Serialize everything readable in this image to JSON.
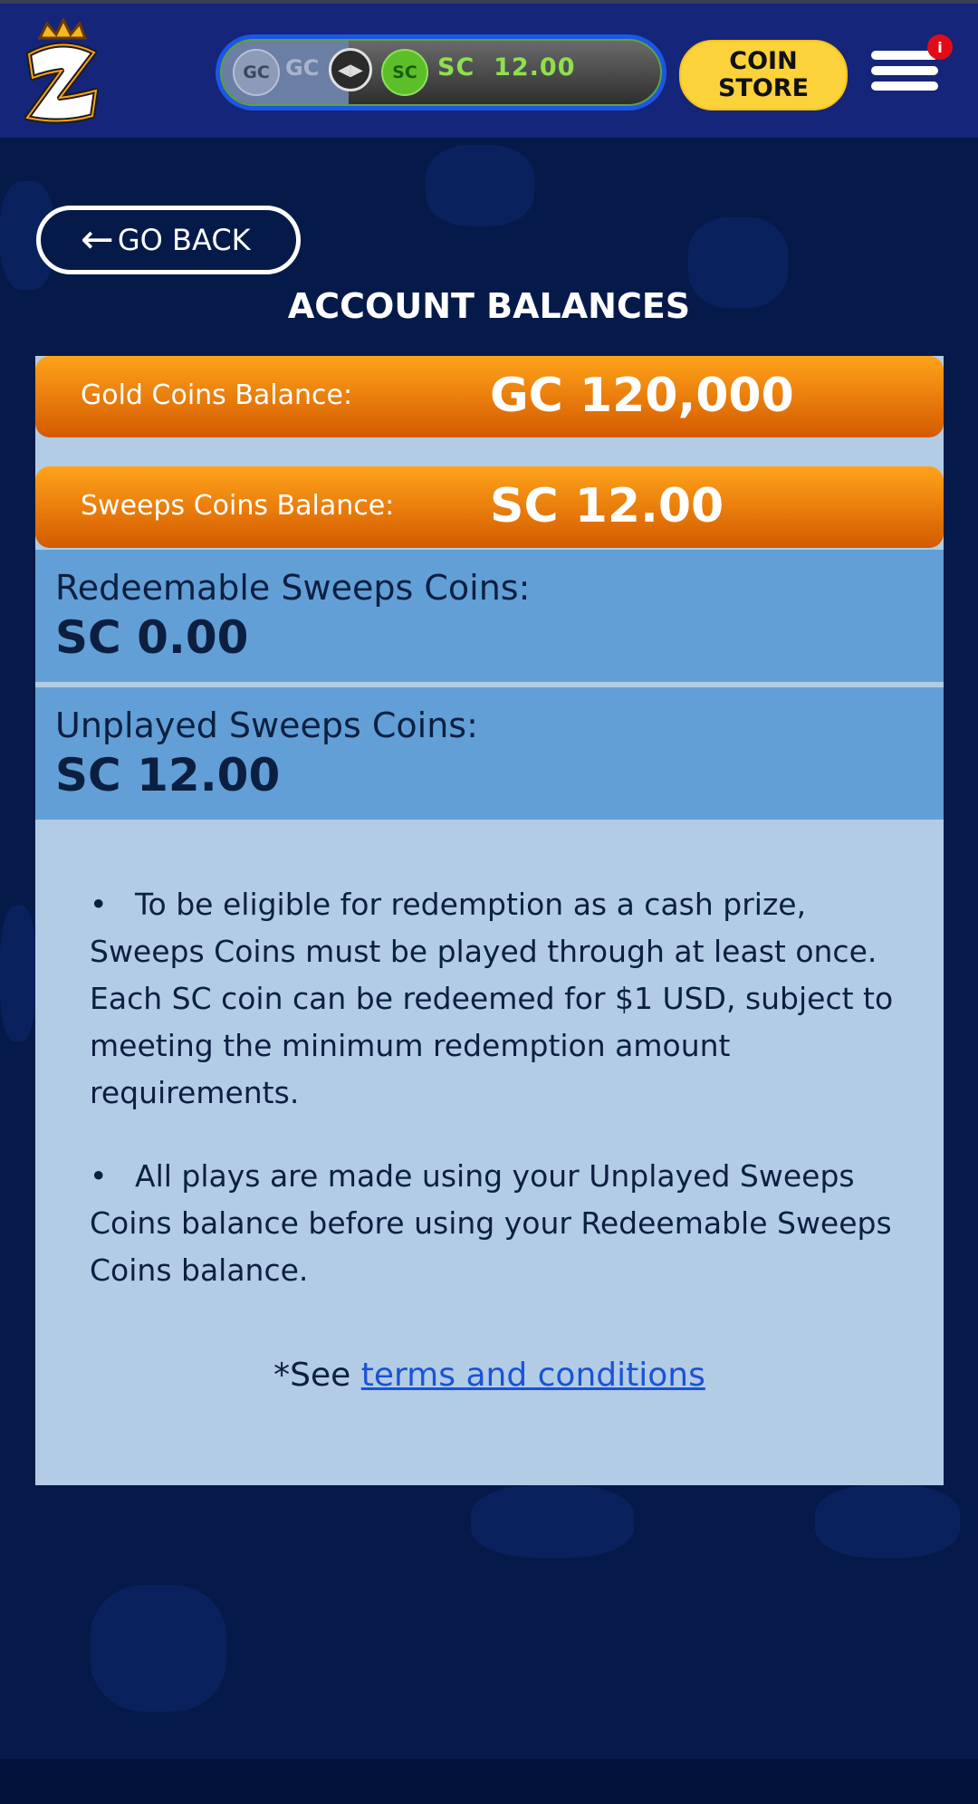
{
  "header": {
    "logo_letter": "Z",
    "toggle": {
      "gc_coin": "GC",
      "gc_label": "GC",
      "sc_coin": "SC",
      "sc_label": "SC",
      "sc_amount": "12.00"
    },
    "coin_store": {
      "line1": "COIN",
      "line2": "STORE"
    },
    "menu_badge": "i"
  },
  "go_back_label": "GO BACK",
  "page_title": "ACCOUNT BALANCES",
  "balances": {
    "gold": {
      "label": "Gold Coins Balance:",
      "value": "GC 120,000"
    },
    "sweeps": {
      "label": "Sweeps Coins Balance:",
      "value": "SC 12.00"
    },
    "redeemable": {
      "label": "Redeemable Sweeps Coins:",
      "value": "SC 0.00"
    },
    "unplayed": {
      "label": "Unplayed Sweeps Coins:",
      "value": "SC 12.00"
    }
  },
  "info": [
    {
      "bullet": "•",
      "text": "To be eligible for redemption as a cash prize, Sweeps Coins must be played through at least once. Each SC coin can be redeemed for $1 USD, subject to meeting the minimum redemption amount requirements."
    },
    {
      "bullet": "•",
      "text": "All plays are made using your Unplayed Sweeps Coins balance before using your Redeemable Sweeps Coins balance."
    }
  ],
  "terms": {
    "prefix": "*See ",
    "link": "terms and conditions"
  },
  "colors": {
    "accent_orange": "#ff9f1a",
    "sweeps_green": "#5cbf2a",
    "coin_store_yellow": "#fbd23a",
    "navy_bg": "#061a4a"
  }
}
